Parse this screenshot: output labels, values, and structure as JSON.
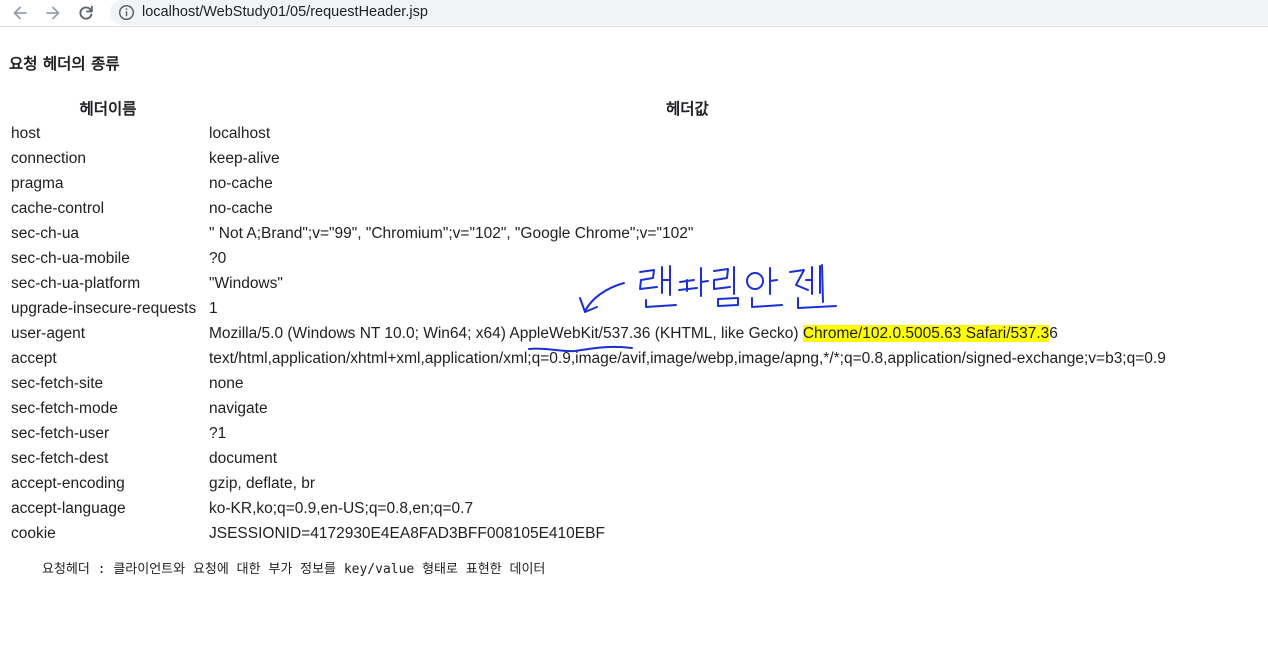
{
  "browser": {
    "url": "localhost/WebStudy01/05/requestHeader.jsp"
  },
  "page": {
    "heading": "요청 헤더의 종류",
    "table": {
      "columns": [
        "헤더이름",
        "헤더값"
      ],
      "rows": [
        {
          "name": "host",
          "value": "localhost"
        },
        {
          "name": "connection",
          "value": "keep-alive"
        },
        {
          "name": "pragma",
          "value": "no-cache"
        },
        {
          "name": "cache-control",
          "value": "no-cache"
        },
        {
          "name": "sec-ch-ua",
          "value": "\" Not A;Brand\";v=\"99\", \"Chromium\";v=\"102\", \"Google Chrome\";v=\"102\""
        },
        {
          "name": "sec-ch-ua-mobile",
          "value": "?0"
        },
        {
          "name": "sec-ch-ua-platform",
          "value": "\"Windows\""
        },
        {
          "name": "upgrade-insecure-requests",
          "value": "1"
        },
        {
          "name": "user-agent",
          "value": "Mozilla/5.0 (Windows NT 10.0; Win64; x64) AppleWebKit/537.36 (KHTML, like Gecko) Chrome/102.0.5005.63 Safari/537.36",
          "highlight": "Chrome/102.0.5005.63 Safari/537.3"
        },
        {
          "name": "accept",
          "value": "text/html,application/xhtml+xml,application/xml;q=0.9,image/avif,image/webp,image/apng,*/*;q=0.8,application/signed-exchange;v=b3;q=0.9"
        },
        {
          "name": "sec-fetch-site",
          "value": "none"
        },
        {
          "name": "sec-fetch-mode",
          "value": "navigate"
        },
        {
          "name": "sec-fetch-user",
          "value": "?1"
        },
        {
          "name": "sec-fetch-dest",
          "value": "document"
        },
        {
          "name": "accept-encoding",
          "value": "gzip, deflate, br"
        },
        {
          "name": "accept-language",
          "value": "ko-KR,ko;q=0.9,en-US;q=0.8,en;q=0.7"
        },
        {
          "name": "cookie",
          "value": "JSESSIONID=4172930E4EA8FAD3BFF008105E410EBF"
        }
      ]
    },
    "footnote": "요청헤더 : 클라이언트와 요청에 대한 부가 정보를 key/value 형태로 표현한 데이터"
  },
  "annotation": {
    "handwritten_text": "렌더링엔진",
    "ink_color": "#1a2fd6",
    "highlight_color": "#ffff00"
  },
  "icons": {
    "back": "arrow-left-icon",
    "forward": "arrow-right-icon",
    "reload": "reload-icon",
    "site_info": "info-circle-icon"
  }
}
